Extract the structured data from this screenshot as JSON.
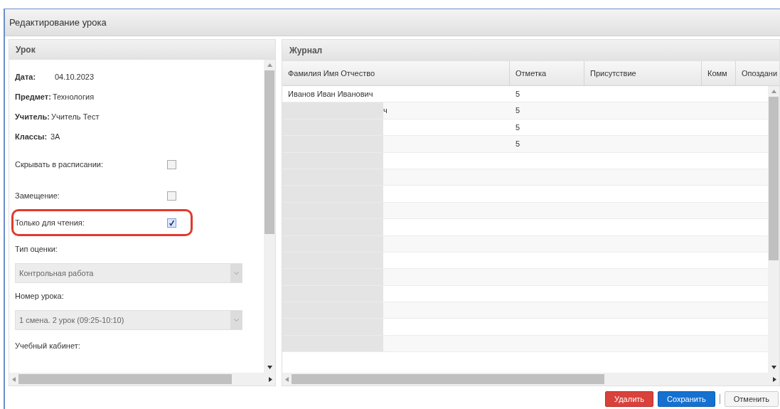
{
  "window": {
    "title": "Редактирование урока"
  },
  "lesson_panel": {
    "title": "Урок",
    "info": [
      {
        "label": "Дата:",
        "value": "04.10.2023"
      },
      {
        "label": "Предмет:",
        "value": "Технология"
      },
      {
        "label": "Учитель:",
        "value": "Учитель Тест"
      },
      {
        "label": "Классы:",
        "value": "3А"
      }
    ],
    "checkboxes": [
      {
        "label": "Скрывать в расписании:",
        "checked": false,
        "highlighted": false
      },
      {
        "label": "Замещение:",
        "checked": false,
        "highlighted": false
      },
      {
        "label": "Только для чтения:",
        "checked": true,
        "highlighted": true
      }
    ],
    "selects": [
      {
        "label": "Тип оценки:",
        "value": "Контрольная работа",
        "disabled": true
      },
      {
        "label": "Номер урока:",
        "value": "1 смена. 2 урок (09:25-10:10)",
        "disabled": true
      }
    ],
    "cut_label": "Учебный кабинет:"
  },
  "journal_panel": {
    "title": "Журнал",
    "columns": [
      "Фамилия Имя Отчество",
      "Отметка",
      "Присутствие",
      "Комм",
      "Опоздани"
    ],
    "rows": [
      {
        "name": "Иванов Иван Иванович",
        "mark": "5",
        "redacted": false
      },
      {
        "name": "ч",
        "mark": "5",
        "redacted": true
      },
      {
        "name": "",
        "mark": "5",
        "redacted": true
      },
      {
        "name": "",
        "mark": "5",
        "redacted": true
      },
      {
        "name": "",
        "mark": "",
        "redacted": true
      },
      {
        "name": "",
        "mark": "",
        "redacted": true
      },
      {
        "name": "",
        "mark": "",
        "redacted": true
      },
      {
        "name": "",
        "mark": "",
        "redacted": true
      },
      {
        "name": "",
        "mark": "",
        "redacted": true
      },
      {
        "name": "",
        "mark": "",
        "redacted": true
      },
      {
        "name": "",
        "mark": "",
        "redacted": true
      },
      {
        "name": "",
        "mark": "",
        "redacted": true
      },
      {
        "name": "",
        "mark": "",
        "redacted": true
      },
      {
        "name": "",
        "mark": "",
        "redacted": true
      },
      {
        "name": "",
        "mark": "",
        "redacted": true
      },
      {
        "name": "",
        "mark": "",
        "redacted": true
      }
    ]
  },
  "buttons": [
    {
      "label": "Удалить",
      "kind": "danger"
    },
    {
      "label": "Сохранить",
      "kind": "primary"
    },
    {
      "label": "Отменить",
      "kind": "plain"
    }
  ]
}
